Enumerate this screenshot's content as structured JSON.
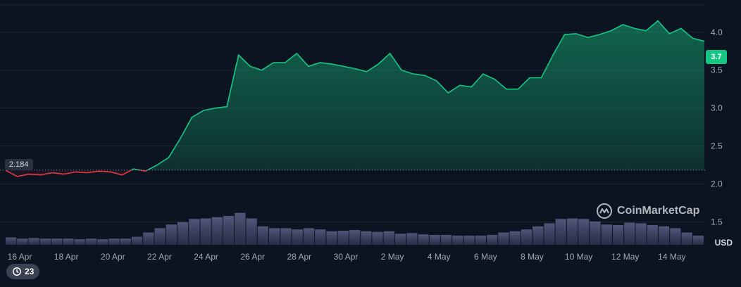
{
  "chart_data": {
    "type": "area",
    "title": "",
    "unit": "USD",
    "current_price_label": "3.7",
    "open_price_label": "2.184",
    "open_price": 2.184,
    "ylim": [
      1.2,
      4.35
    ],
    "yticks": [
      "4.0",
      "3.5",
      "3.0",
      "2.5",
      "2.0",
      "1.5"
    ],
    "ytick_values": [
      4.0,
      3.5,
      3.0,
      2.5,
      2.0,
      1.5
    ],
    "xticks": [
      "16 Apr",
      "18 Apr",
      "20 Apr",
      "22 Apr",
      "24 Apr",
      "26 Apr",
      "28 Apr",
      "30 Apr",
      "2 May",
      "4 May",
      "6 May",
      "8 May",
      "10 May",
      "12 May",
      "14 May"
    ],
    "grid": true,
    "series": [
      {
        "x": [
          0,
          0.5,
          1,
          1.5,
          2,
          2.5,
          3,
          3.5,
          4,
          4.5,
          5,
          5.5,
          6,
          6.5,
          7,
          7.5,
          8,
          8.5,
          9,
          9.5,
          10,
          10.5,
          11,
          11.5,
          12,
          12.5,
          13,
          13.5,
          14,
          14.5,
          15,
          15.5,
          16,
          16.5,
          17,
          17.5,
          18,
          18.5,
          19,
          19.5,
          20,
          20.5,
          21,
          21.5,
          22,
          22.5,
          23,
          23.5,
          24,
          24.5,
          25,
          25.5,
          26,
          26.5,
          27,
          27.5,
          28,
          28.5,
          29,
          29.5,
          30
        ],
        "values": [
          2.18,
          2.1,
          2.13,
          2.12,
          2.15,
          2.13,
          2.16,
          2.15,
          2.17,
          2.16,
          2.12,
          2.2,
          2.17,
          2.25,
          2.35,
          2.6,
          2.88,
          2.97,
          3.0,
          3.02,
          3.7,
          3.55,
          3.5,
          3.6,
          3.6,
          3.72,
          3.55,
          3.6,
          3.58,
          3.55,
          3.52,
          3.48,
          3.58,
          3.72,
          3.5,
          3.45,
          3.43,
          3.36,
          3.2,
          3.3,
          3.28,
          3.45,
          3.38,
          3.25,
          3.25,
          3.4,
          3.4,
          3.7,
          3.97,
          3.98,
          3.93,
          3.97,
          4.02,
          4.1,
          4.05,
          4.02,
          4.15,
          3.98,
          4.05,
          3.92,
          3.88
        ]
      }
    ],
    "volume": [
      0.12,
      0.1,
      0.11,
      0.1,
      0.1,
      0.1,
      0.09,
      0.1,
      0.09,
      0.1,
      0.1,
      0.13,
      0.2,
      0.27,
      0.33,
      0.37,
      0.42,
      0.43,
      0.45,
      0.47,
      0.52,
      0.43,
      0.3,
      0.27,
      0.27,
      0.25,
      0.27,
      0.25,
      0.22,
      0.23,
      0.24,
      0.22,
      0.21,
      0.22,
      0.18,
      0.19,
      0.17,
      0.16,
      0.16,
      0.15,
      0.15,
      0.15,
      0.16,
      0.2,
      0.22,
      0.25,
      0.3,
      0.35,
      0.42,
      0.43,
      0.42,
      0.38,
      0.33,
      0.32,
      0.36,
      0.35,
      0.32,
      0.3,
      0.27,
      0.2,
      0.15
    ]
  },
  "watermark": {
    "brand": "CoinMarketCap"
  },
  "history_button": {
    "count": "23"
  },
  "colors": {
    "up": "#16c784",
    "down": "#ea3943",
    "background": "#0d1421",
    "grid": "#1f2633",
    "volume": "#4b5275"
  }
}
